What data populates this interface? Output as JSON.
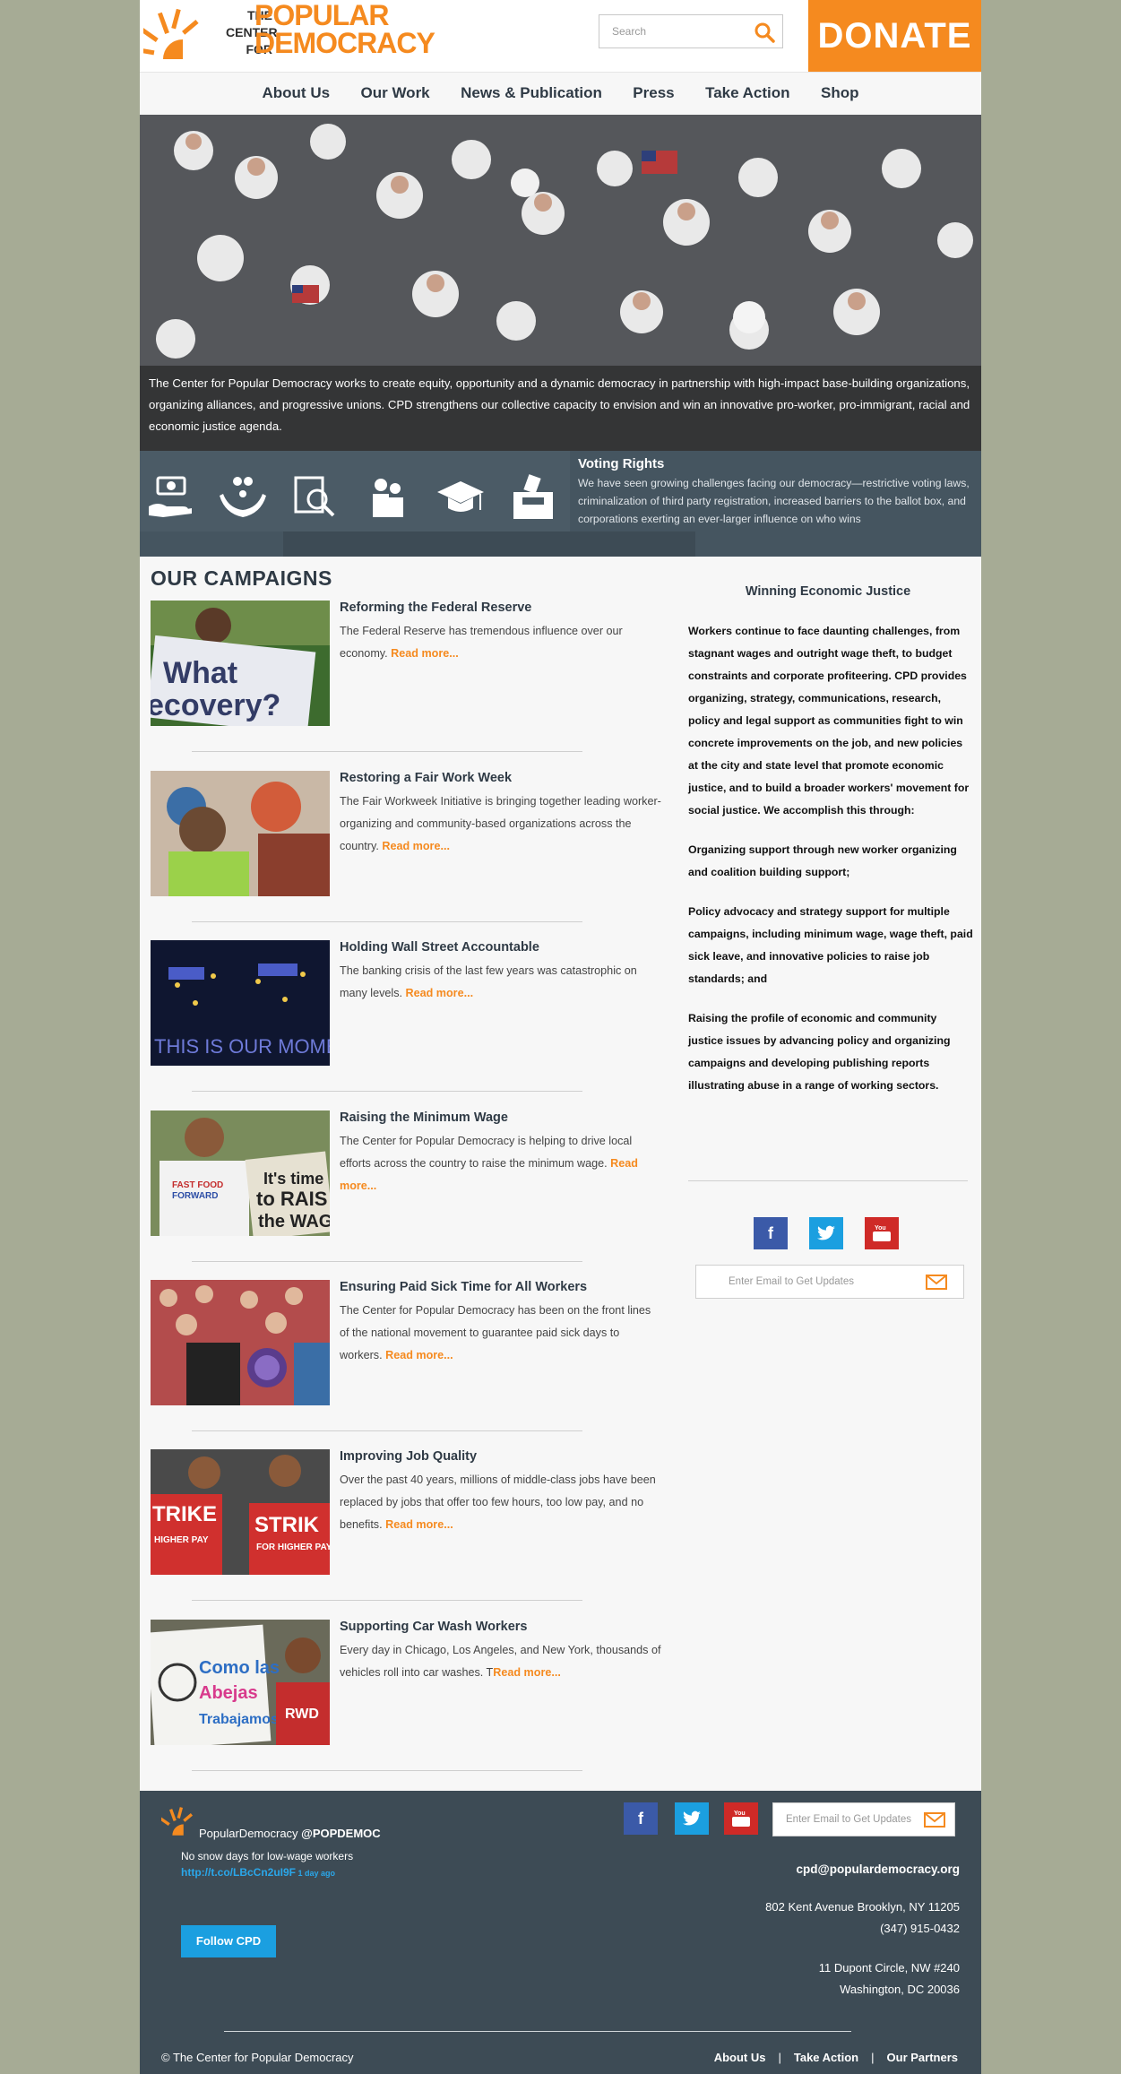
{
  "header": {
    "logo_small": "THE\nCENTER\nFOR",
    "logo_big": "POPULAR\nDEMOCRACY",
    "search_placeholder": "Search",
    "donate_label": "DONATE"
  },
  "nav": [
    "About Us",
    "Our Work",
    "News & Publication",
    "Press",
    "Take Action",
    "Shop"
  ],
  "hero": {
    "caption": "The Center for Popular Democracy works to create equity, opportunity and a dynamic democracy in partnership with high-impact base-building organizations, organizing alliances, and progressive unions. CPD strengthens our collective capacity to envision and win an innovative pro-worker, pro-immigrant, racial and economic justice agenda."
  },
  "issues": {
    "icons": [
      "money-hand-icon",
      "family-hands-icon",
      "document-search-icon",
      "people-icon",
      "graduation-cap-icon",
      "ballot-box-icon"
    ],
    "title": "Voting Rights",
    "text": "We have seen growing challenges facing our democracy—restrictive voting laws, criminalization of third party registration, increased barriers to the ballot box, and corporations exerting an ever-larger influence on who wins"
  },
  "campaigns": {
    "heading": "OUR CAMPAIGNS",
    "read_more": "Read more...",
    "items": [
      {
        "title": "Reforming the Federal Reserve",
        "desc": "The Federal Reserve has tremendous influence over our economy. ",
        "more": "Read more...",
        "sign_text": "What\necovery?"
      },
      {
        "title": "Restoring a Fair Work Week",
        "desc": "The Fair Workweek Initiative is bringing together leading worker-organizing and community-based organizations across the country. ",
        "more": "Read more...",
        "sign_text": ""
      },
      {
        "title": "Holding Wall Street Accountable",
        "desc": "The banking crisis of the last few years was catastrophic on many levels. ",
        "more": "Read more...",
        "sign_text": "THIS IS OUR MOMENT"
      },
      {
        "title": "Raising the Minimum Wage",
        "desc": "The Center for Popular Democracy is helping to drive local efforts across the country to raise the minimum wage. ",
        "more": "Read more...",
        "sign_text": "It's time to RAISE the WAGE"
      },
      {
        "title": "Ensuring Paid Sick Time for All Workers",
        "desc": "The Center for Popular Democracy has been on the front lines of the national movement to guarantee paid sick days to workers. ",
        "more": "Read more...",
        "sign_text": ""
      },
      {
        "title": "Improving Job Quality",
        "desc": "Over the past 40 years, millions of middle-class jobs have been replaced by jobs that offer too few hours, too low pay, and no benefits. ",
        "more": "Read more...",
        "sign_text": "STRIKE"
      },
      {
        "title": "Supporting Car Wash Workers",
        "desc": "Every day in Chicago, Los Angeles, and New York, thousands of vehicles roll into car washes. T",
        "more": "Read more...",
        "sign_text": "Como las Abejas Trabajamos"
      }
    ]
  },
  "sidebar": {
    "title": "Winning Economic Justice",
    "paragraphs": [
      "Workers continue to face daunting challenges, from stagnant wages and outright wage theft, to budget constraints and corporate profiteering. CPD provides organizing, strategy, communications, research, policy and legal support as communities fight to win concrete improvements on the job, and new policies at the city and state level that promote economic justice, and to build a broader workers' movement for social justice. We accomplish this through:",
      "Organizing support through new worker organizing and coalition building support;",
      "Policy advocacy and strategy support for multiple campaigns, including minimum wage, wage theft, paid sick leave, and innovative policies to raise job standards; and",
      "Raising the profile of economic and community justice issues by advancing policy and organizing campaigns and developing publishing reports illustrating abuse in a range of working sectors."
    ],
    "email_placeholder": "Enter Email to Get Updates"
  },
  "footer": {
    "handle_name": "PopularDemocracy ",
    "handle_at": "@POPDEMOC",
    "tweet": "No snow days for low-wage workers",
    "tweet_link": "http://t.co/LBcCn2uI9F",
    "tweet_age": " 1 day ago",
    "follow_label": "Follow CPD",
    "email_placeholder": "Enter Email to Get Updates",
    "contact_email": "cpd@populardemocracy.org",
    "address1_line1": "802 Kent Avenue Brooklyn, NY 11205",
    "address1_line2": "(347) 915-0432",
    "address2_line1": "11 Dupont Circle, NW #240",
    "address2_line2": "Washington, DC 20036",
    "copyright": "© The Center for Popular Democracy",
    "links": [
      "About Us",
      "Take Action",
      "Our Partners"
    ]
  },
  "colors": {
    "brand_orange": "#f58a1f",
    "dark_slate": "#3d4b55",
    "facebook": "#3b5aa8",
    "twitter": "#1b9fe0",
    "youtube": "#cf2a27"
  }
}
